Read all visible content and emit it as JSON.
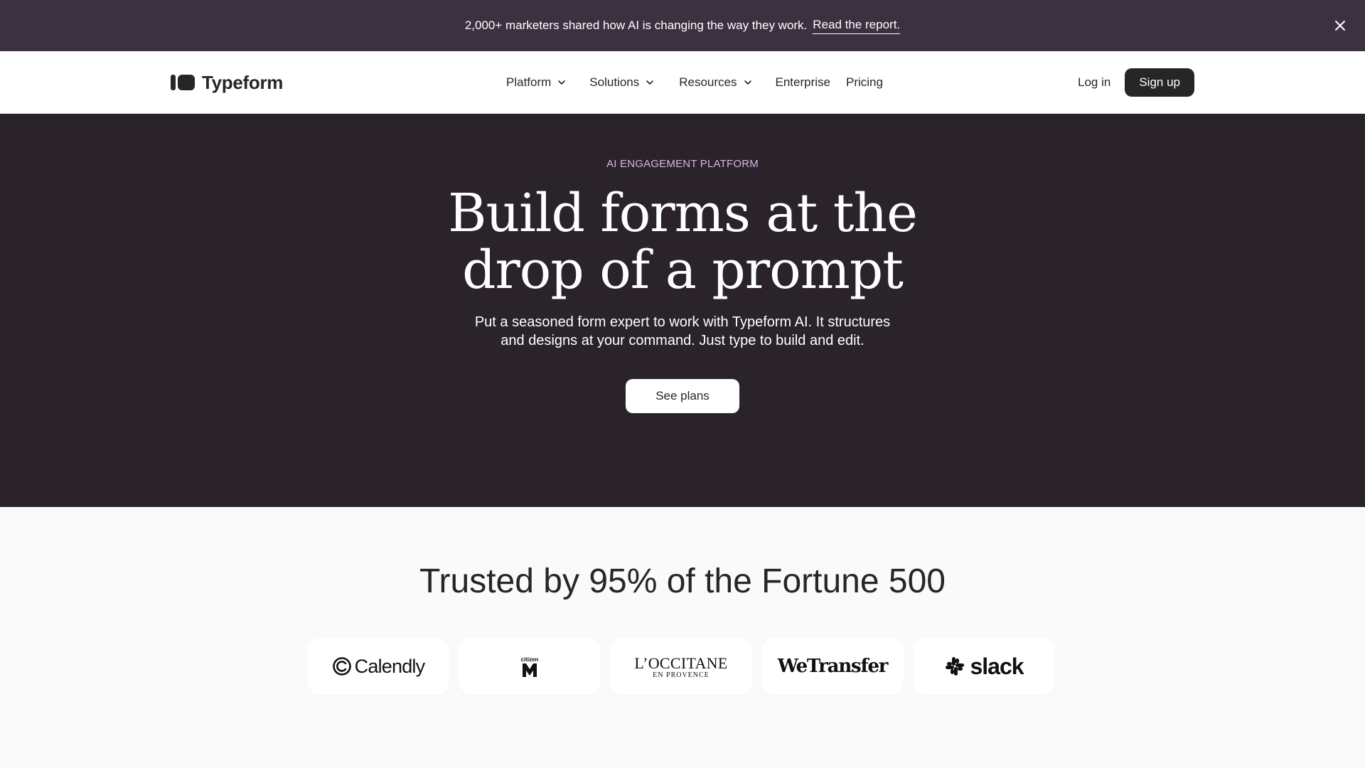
{
  "announcement": {
    "text": "2,000+ marketers shared how AI is changing the way they work.",
    "link": "Read the report."
  },
  "nav": {
    "brand": "Typeform",
    "items": [
      {
        "label": "Platform",
        "dropdown": true
      },
      {
        "label": "Solutions",
        "dropdown": true
      },
      {
        "label": "Resources",
        "dropdown": true
      },
      {
        "label": "Enterprise",
        "dropdown": false
      },
      {
        "label": "Pricing",
        "dropdown": false
      }
    ],
    "login": "Log in",
    "signup": "Sign up"
  },
  "hero": {
    "eyebrow": "AI ENGAGEMENT PLATFORM",
    "title_line1": "Build forms at the",
    "title_line2": "drop of a prompt",
    "subtitle_line1": "Put a seasoned form expert to work with Typeform AI. It structures",
    "subtitle_line2": "and designs at your command. Just type to build and edit.",
    "cta": "See plans"
  },
  "trusted": {
    "title": "Trusted by 95% of the Fortune 500",
    "logos": [
      {
        "name": "Calendly",
        "icon": "calendly-logo"
      },
      {
        "name": "citizen M",
        "icon": "citizenm-logo"
      },
      {
        "name": "L'OCCITANE EN PROVENCE",
        "icon": "loccitane-logo"
      },
      {
        "name": "WeTransfer",
        "icon": "wetransfer-logo"
      },
      {
        "name": "slack",
        "icon": "slack-logo"
      }
    ]
  },
  "colors": {
    "announcement_bg": "#3b3140",
    "hero_bg": "#2a232a",
    "eyebrow": "#d9b3e6",
    "dark": "#262627",
    "page_bg": "#fafafb"
  }
}
